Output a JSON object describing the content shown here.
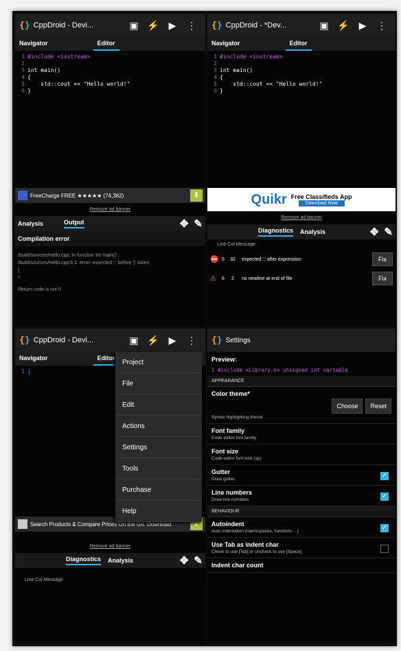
{
  "app": {
    "name": "CppDroid - Devi...",
    "name_alt": "CppDroid - *Dev..."
  },
  "tabs": {
    "navigator": "Navigator",
    "editor": "Editor"
  },
  "code": {
    "lines": [
      "#include <iostream>",
      "",
      "int main()",
      "{",
      "    std::cout << \"Hello world!\"",
      "}"
    ]
  },
  "ads": {
    "freecharge": "FreeCharge  FREE ★★★★★  (74,382)",
    "quikr_logo": "Quikr",
    "quikr_text": "Free Classifieds App",
    "quikr_btn": "Download Now",
    "search_ad": "Search Products & Compare Prices On the Go. Download",
    "remove": "Remove ad banner"
  },
  "panel1": {
    "tab_analysis": "Analysis",
    "tab_output": "Output",
    "compile_title": "Compilation error",
    "out_lines": [
      "/build/sources/Hello.cpp: In function 'int main()':",
      "/build/sources/Hello.cpp:6:1: error: expected ';' before '}' token",
      "}",
      "^",
      "Return code is not 0"
    ]
  },
  "panel2": {
    "tab_diag": "Diagnostics",
    "tab_analysis": "Analysis",
    "col_header": "Line  Col   Message",
    "rows": [
      {
        "line": "5",
        "col": "32",
        "msg": "expected ';' after expression",
        "btn": "Fix"
      },
      {
        "line": "6",
        "col": "2",
        "msg": "no newline at end of file",
        "btn": "Fix"
      }
    ]
  },
  "menu": {
    "items": [
      "Project",
      "File",
      "Edit",
      "Actions",
      "Settings",
      "Tools",
      "Purchase",
      "Help"
    ]
  },
  "panel3": {
    "line1": "1",
    "tab_diag": "Diagnostics",
    "tab_analysis": "Analysis",
    "col_header": "Line  Col   Message"
  },
  "settings": {
    "title": "Settings",
    "preview": "Preview:",
    "preview_code": "#include <Library.h> unsigned int variable",
    "appearance": "APPEARANCE",
    "color_theme": "Color theme*",
    "color_theme_sub": "Syntax highlighting theme",
    "choose": "Choose",
    "reset": "Reset",
    "font_family": "Font family",
    "font_family_sub": "Code editor font family",
    "font_size": "Font size",
    "font_size_sub": "Code editor font size (sp)",
    "gutter": "Gutter",
    "gutter_sub": "Draw gutter",
    "line_numbers": "Line numbers",
    "line_numbers_sub": "Draw line numbers",
    "behaviour": "BEHAVIOUR",
    "autoindent": "Autoindent",
    "autoindent_sub": "Auto indentation (namespaces, functions ...)",
    "usetab": "Use Tab as indent char",
    "usetab_sub": "Check to use [Tab] or uncheck to use [Space]",
    "indent_size": "Indent char count"
  }
}
